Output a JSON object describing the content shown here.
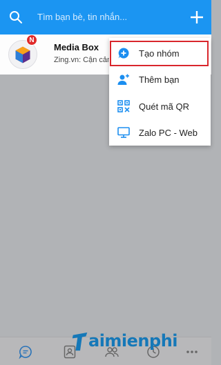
{
  "search": {
    "placeholder": "Tìm bạn bè, tin nhắn..."
  },
  "conversation": {
    "name": "Media Box",
    "preview": "Zing.vn: Cận cảnh",
    "badge": "N"
  },
  "menu": {
    "items": [
      {
        "label": "Tạo nhóm",
        "icon": "create-group-icon"
      },
      {
        "label": "Thêm bạn",
        "icon": "add-friend-icon"
      },
      {
        "label": "Quét mã QR",
        "icon": "qr-scan-icon"
      },
      {
        "label": "Zalo PC - Web",
        "icon": "desktop-icon"
      }
    ]
  },
  "bottom_tabs": [
    {
      "icon": "messages-icon"
    },
    {
      "icon": "contacts-icon"
    },
    {
      "icon": "groups-icon"
    },
    {
      "icon": "timeline-icon"
    },
    {
      "icon": "more-icon"
    }
  ],
  "watermark": {
    "text": "aimienphi"
  },
  "colors": {
    "header": "#1b95f2",
    "accent": "#1b8ef0",
    "highlight_border": "#d9262c",
    "overlay": "#b1b3b6"
  }
}
